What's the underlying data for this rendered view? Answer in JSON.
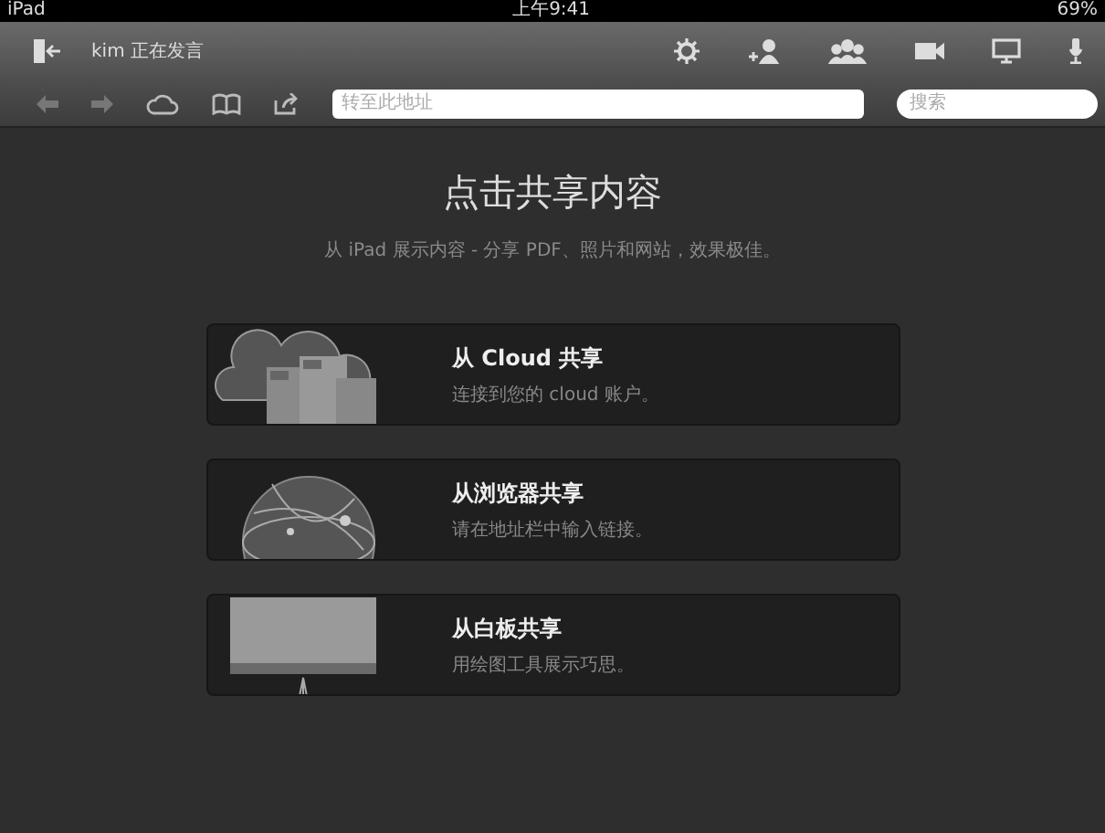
{
  "status_bar": {
    "device": "iPad",
    "time": "上午9:41",
    "battery": "69%"
  },
  "top_toolbar": {
    "speaker_text": "kim 正在发言"
  },
  "browser_toolbar": {
    "address": {
      "placeholder": "转至此地址"
    },
    "search": {
      "placeholder": "搜索"
    }
  },
  "header": {
    "title": "点击共享内容",
    "subtitle": "从 iPad 展示内容 - 分享 PDF、照片和网站，效果极佳。"
  },
  "options": [
    {
      "kind": "cloud",
      "title": "从 Cloud 共享",
      "description": "连接到您的 cloud 账户。"
    },
    {
      "kind": "browser",
      "title": "从浏览器共享",
      "description": "请在地址栏中输入链接。"
    },
    {
      "kind": "whiteboard",
      "title": "从白板共享",
      "description": "用绘图工具展示巧思。"
    }
  ]
}
